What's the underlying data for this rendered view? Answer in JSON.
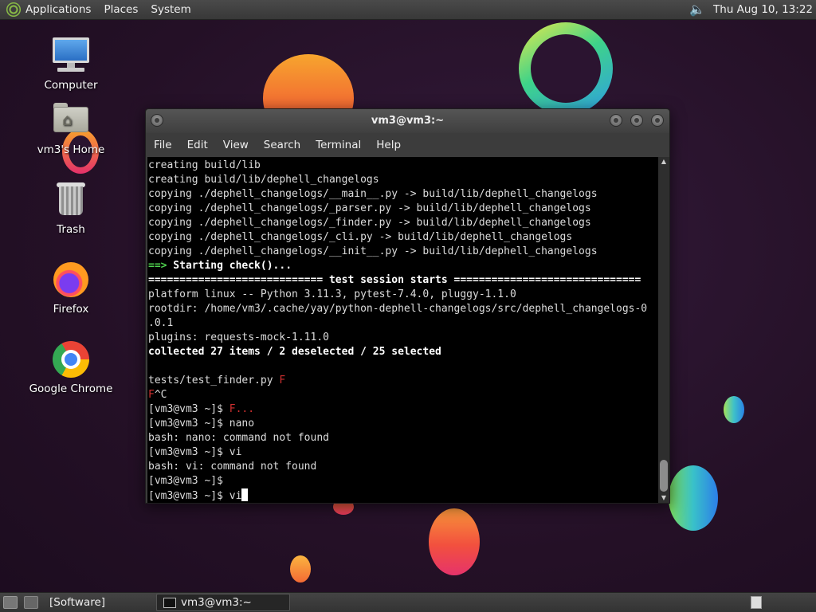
{
  "top_panel": {
    "menus": [
      "Applications",
      "Places",
      "System"
    ],
    "clock": "Thu Aug 10, 13:22",
    "volume_icon": "volume-icon"
  },
  "desktop_icons": [
    {
      "label": "Computer",
      "icon": "computer-icon"
    },
    {
      "label": "vm3's Home",
      "icon": "home-folder-icon"
    },
    {
      "label": "Trash",
      "icon": "trash-icon"
    },
    {
      "label": "Firefox",
      "icon": "firefox-icon"
    },
    {
      "label": "Google Chrome",
      "icon": "chrome-icon"
    }
  ],
  "terminal": {
    "title": "vm3@vm3:~",
    "menu": [
      "File",
      "Edit",
      "View",
      "Search",
      "Terminal",
      "Help"
    ],
    "lines": [
      {
        "text": "creating build/lib",
        "style": ""
      },
      {
        "text": "creating build/lib/dephell_changelogs",
        "style": ""
      },
      {
        "text": "copying ./dephell_changelogs/__main__.py -> build/lib/dephell_changelogs",
        "style": ""
      },
      {
        "text": "copying ./dephell_changelogs/_parser.py -> build/lib/dephell_changelogs",
        "style": ""
      },
      {
        "text": "copying ./dephell_changelogs/_finder.py -> build/lib/dephell_changelogs",
        "style": ""
      },
      {
        "text": "copying ./dephell_changelogs/_cli.py -> build/lib/dephell_changelogs",
        "style": ""
      },
      {
        "text": "copying ./dephell_changelogs/__init__.py -> build/lib/dephell_changelogs",
        "style": ""
      },
      {
        "text": "==> Starting check()...",
        "style": "start"
      },
      {
        "text": "============================ test session starts ==============================",
        "style": "bold"
      },
      {
        "text": "platform linux -- Python 3.11.3, pytest-7.4.0, pluggy-1.1.0",
        "style": ""
      },
      {
        "text": "rootdir: /home/vm3/.cache/yay/python-dephell-changelogs/src/dephell_changelogs-0",
        "style": ""
      },
      {
        "text": ".0.1",
        "style": ""
      },
      {
        "text": "plugins: requests-mock-1.11.0",
        "style": ""
      },
      {
        "text": "collected 27 items / 2 deselected / 25 selected",
        "style": "bold"
      },
      {
        "text": "",
        "style": ""
      },
      {
        "text": "tests/test_finder.py ",
        "style": "",
        "red": "F"
      },
      {
        "text": "^C",
        "style": "",
        "red_prefix": "F"
      },
      {
        "text": "[vm3@vm3 ~]$ ",
        "style": "",
        "red": "F..."
      },
      {
        "text": "[vm3@vm3 ~]$ nano",
        "style": ""
      },
      {
        "text": "bash: nano: command not found",
        "style": ""
      },
      {
        "text": "[vm3@vm3 ~]$ vi",
        "style": ""
      },
      {
        "text": "bash: vi: command not found",
        "style": ""
      },
      {
        "text": "[vm3@vm3 ~]$",
        "style": ""
      },
      {
        "text": "[vm3@vm3 ~]$ vi",
        "style": "",
        "cursor": true
      }
    ]
  },
  "bottom_panel": {
    "tasks": [
      "[Software]",
      "vm3@vm3:~"
    ]
  }
}
